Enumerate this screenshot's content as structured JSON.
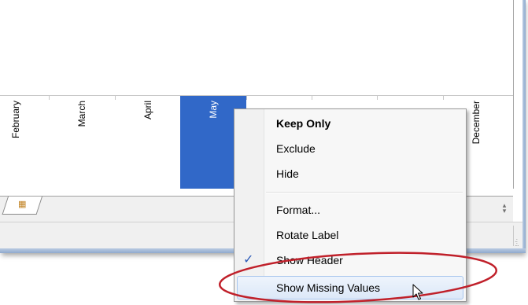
{
  "headers": {
    "months": [
      "February",
      "March",
      "April",
      "May",
      "",
      "",
      "",
      "December"
    ],
    "selected": "May"
  },
  "context_menu": {
    "items": [
      {
        "label": "Keep Only",
        "bold": true
      },
      {
        "label": "Exclude"
      },
      {
        "label": "Hide"
      },
      {
        "label": "Format..."
      },
      {
        "label": "Rotate Label"
      },
      {
        "label": "Show Header",
        "checked": true
      },
      {
        "label": "Show Missing Values",
        "highlighted": true
      }
    ]
  },
  "icons": {
    "new_sheet": "new-worksheet-icon",
    "check": "checkmark-icon",
    "cursor": "mouse-pointer-icon",
    "scroll": "scroll-arrows-icon",
    "grip": "size-grip-icon"
  },
  "colors": {
    "selection": "#3168c8",
    "annotation": "#c0202a",
    "menu_highlight": "#dce8f8"
  }
}
